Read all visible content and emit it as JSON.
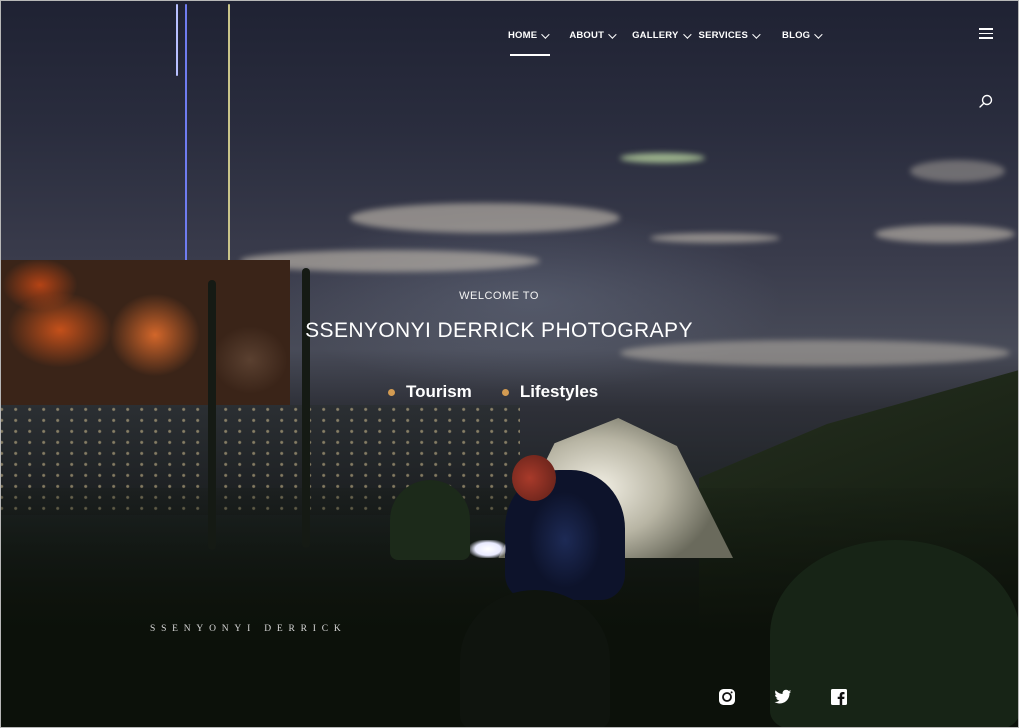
{
  "nav": {
    "items": [
      {
        "label": "HOME",
        "icon": "chevron-down-icon",
        "active": true
      },
      {
        "label": "ABOUT",
        "icon": "chevron-down-icon",
        "active": false
      },
      {
        "label": "GALLERY",
        "icon": "chevron-down-icon",
        "active": false
      },
      {
        "label": "SERVICES",
        "icon": "chevron-down-icon",
        "active": false
      },
      {
        "label": "BLOG",
        "icon": "chevron-down-icon",
        "active": false
      }
    ],
    "menu_icon": "hamburger-menu-icon",
    "search_icon": "search-icon"
  },
  "hero": {
    "welcome": "WELCOME TO",
    "title": "SSENYONYI DERRICK PHOTOGRAPY",
    "tags": [
      "Tourism",
      "Lifestyles"
    ],
    "tag_dot_color": "#d39b52"
  },
  "footer": {
    "brand": "SSENYONYI DERRICK",
    "social": [
      "instagram-icon",
      "twitter-icon",
      "facebook-icon"
    ]
  }
}
